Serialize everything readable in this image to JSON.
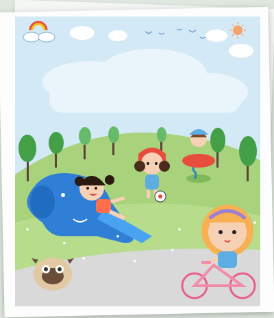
{
  "image": {
    "subject": "",
    "colors": {
      "sky": "#cfe6f5",
      "cloud": "#ffffff",
      "grass": "#a9d27c",
      "grass_dark": "#7fb95a",
      "path": "#d8d8d8",
      "tree": "#43a047",
      "elephant": "#2f7fd6",
      "bike": "#f28aa8",
      "sun": "#f7a26b"
    }
  }
}
